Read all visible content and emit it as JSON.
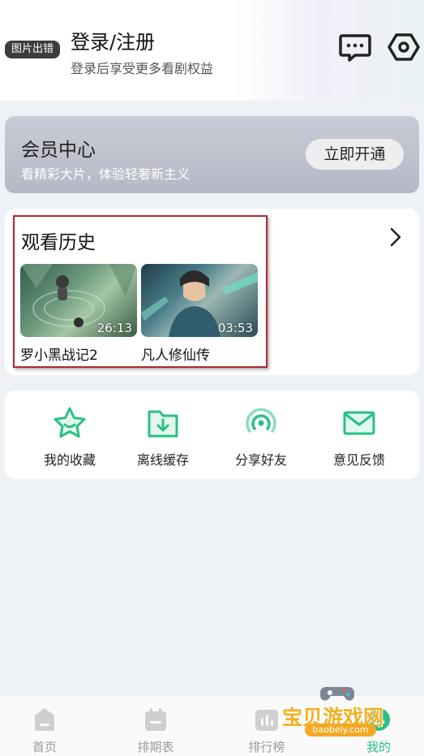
{
  "header": {
    "avatar_label": "图片出错",
    "title": "登录/注册",
    "subtitle": "登录后享受更多看剧权益"
  },
  "vip": {
    "title": "会员中心",
    "subtitle": "看精彩大片，体验轻奢新主义",
    "button": "立即开通"
  },
  "history": {
    "title": "观看历史",
    "items": [
      {
        "name": "罗小黑战记2",
        "time": "26:13"
      },
      {
        "name": "凡人修仙传",
        "time": "03:53"
      }
    ]
  },
  "actions": [
    {
      "label": "我的收藏",
      "icon": "star-icon"
    },
    {
      "label": "离线缓存",
      "icon": "download-folder-icon"
    },
    {
      "label": "分享好友",
      "icon": "share-signal-icon"
    },
    {
      "label": "意见反馈",
      "icon": "mail-icon"
    }
  ],
  "tabbar": [
    {
      "label": "首页",
      "icon": "home-icon"
    },
    {
      "label": "排期表",
      "icon": "calendar-icon"
    },
    {
      "label": "排行榜",
      "icon": "ranking-icon"
    },
    {
      "label": "我的",
      "icon": "profile-icon",
      "active": true
    }
  ],
  "watermark": {
    "text": "宝贝游戏网",
    "url": "baobeiy.com"
  },
  "colors": {
    "accent": "#2bbf86",
    "highlight_border": "#b0282c",
    "vip_bg": "#bfc2cd"
  }
}
